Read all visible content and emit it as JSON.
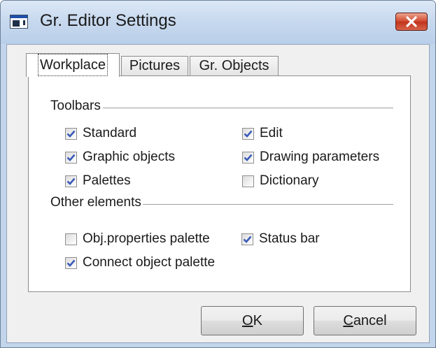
{
  "window": {
    "title": "Gr. Editor Settings",
    "icon": "app-window-icon",
    "close_icon": "close-icon"
  },
  "tabs": [
    {
      "label": "Workplace",
      "active": true
    },
    {
      "label": "Pictures",
      "active": false
    },
    {
      "label": "Gr. Objects",
      "active": false
    }
  ],
  "toolbars": {
    "label": "Toolbars",
    "items": [
      {
        "label": "Standard",
        "checked": true
      },
      {
        "label": "Edit",
        "checked": true
      },
      {
        "label": "Graphic objects",
        "checked": true
      },
      {
        "label": "Drawing parameters",
        "checked": true
      },
      {
        "label": "Palettes",
        "checked": true
      },
      {
        "label": "Dictionary",
        "checked": false
      }
    ]
  },
  "other_elements": {
    "label": "Other elements",
    "items": [
      {
        "label": "Obj.properties palette",
        "checked": false
      },
      {
        "label": "Status bar",
        "checked": true
      },
      {
        "label": "Connect object palette",
        "checked": true
      }
    ]
  },
  "buttons": {
    "ok": {
      "accel": "O",
      "rest": "K"
    },
    "cancel": {
      "accel": "C",
      "rest": "ancel"
    }
  },
  "colors": {
    "title_bar": "#c6d8ee",
    "close_button": "#c9432a",
    "checkmark": "#3a5bb8"
  }
}
